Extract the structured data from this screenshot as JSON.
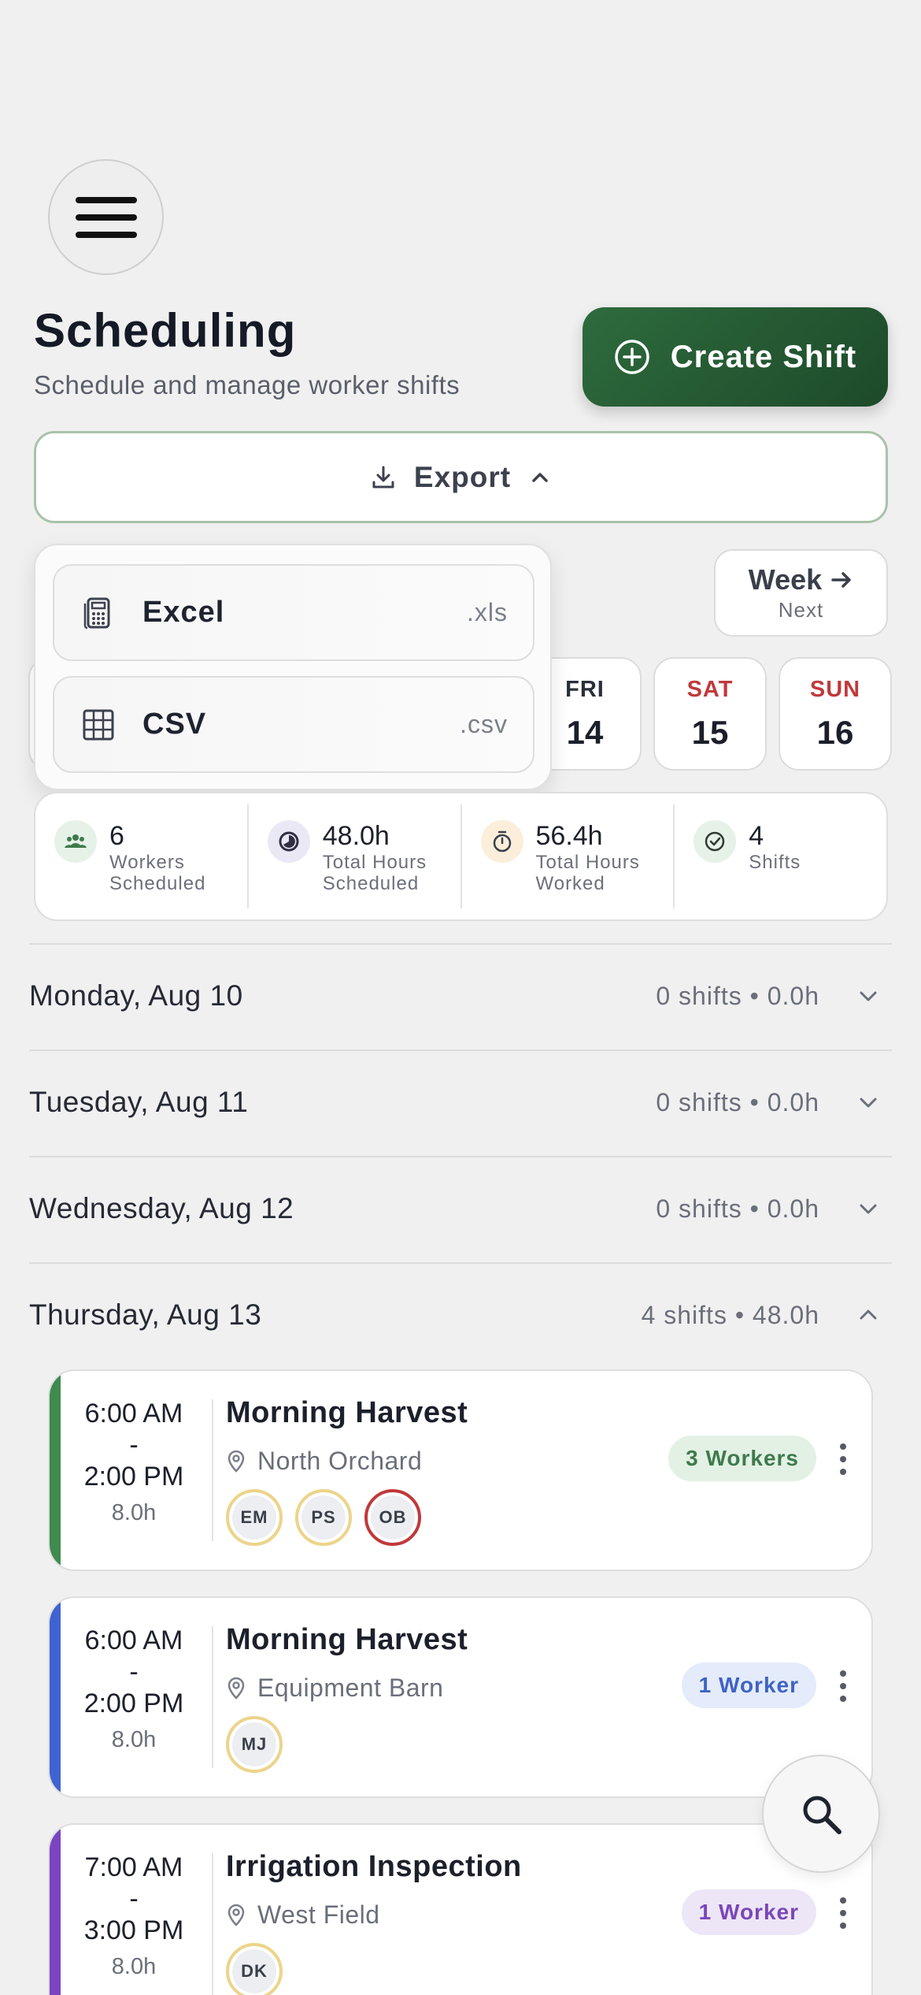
{
  "header": {
    "title": "Scheduling",
    "subtitle": "Schedule and manage worker shifts",
    "create_label": "Create Shift",
    "export_label": "Export"
  },
  "export_menu": [
    {
      "label": "Excel",
      "ext": ".xls",
      "icon": "calculator-icon"
    },
    {
      "label": "CSV",
      "ext": ".csv",
      "icon": "grid-icon"
    }
  ],
  "week_nav": {
    "label": "Week",
    "sub": "Next"
  },
  "day_chips": [
    {
      "name": "FRI",
      "date": "14",
      "weekend": false
    },
    {
      "name": "SAT",
      "date": "15",
      "weekend": true
    },
    {
      "name": "SUN",
      "date": "16",
      "weekend": true
    }
  ],
  "stats": [
    {
      "value": "6",
      "label1": "Workers",
      "label2": "Scheduled",
      "icon": "people-icon",
      "bg": "#e6f2e8",
      "fg": "#3f7a4c"
    },
    {
      "value": "48.0h",
      "label1": "Total Hours",
      "label2": "Scheduled",
      "icon": "clock-half-icon",
      "bg": "#ebe8f6",
      "fg": "#3a3a52"
    },
    {
      "value": "56.4h",
      "label1": "Total Hours",
      "label2": "Worked",
      "icon": "stopwatch-icon",
      "bg": "#fbeeda",
      "fg": "#3a3f4b"
    },
    {
      "value": "4",
      "label1": "Shifts",
      "label2": "",
      "icon": "check-circle-icon",
      "bg": "#e6f2e8",
      "fg": "#2f3a33"
    }
  ],
  "days": [
    {
      "label": "Monday, Aug 10",
      "summary": "0 shifts • 0.0h",
      "expanded": false
    },
    {
      "label": "Tuesday, Aug 11",
      "summary": "0 shifts • 0.0h",
      "expanded": false
    },
    {
      "label": "Wednesday, Aug 12",
      "summary": "0 shifts • 0.0h",
      "expanded": false
    },
    {
      "label": "Thursday, Aug 13",
      "summary": "4 shifts • 48.0h",
      "expanded": true
    }
  ],
  "shifts": [
    {
      "start": "6:00 AM",
      "dash": "-",
      "end": "2:00 PM",
      "hours": "8.0h",
      "title": "Morning Harvest",
      "location": "North Orchard",
      "badge": "3 Workers",
      "badge_bg": "#e3f1e5",
      "badge_fg": "#3f7a4c",
      "accent": "#3f8a4f",
      "workers": [
        {
          "initials": "EM",
          "late": false
        },
        {
          "initials": "PS",
          "late": false
        },
        {
          "initials": "OB",
          "late": true
        }
      ]
    },
    {
      "start": "6:00 AM",
      "dash": "-",
      "end": "2:00 PM",
      "hours": "8.0h",
      "title": "Morning Harvest",
      "location": "Equipment Barn",
      "badge": "1 Worker",
      "badge_bg": "#e4ebfa",
      "badge_fg": "#3f63c4",
      "accent": "#3f63d0",
      "workers": [
        {
          "initials": "MJ",
          "late": false
        }
      ]
    },
    {
      "start": "7:00 AM",
      "dash": "-",
      "end": "3:00 PM",
      "hours": "8.0h",
      "title": "Irrigation Inspection",
      "location": "West Field",
      "badge": "1 Worker",
      "badge_bg": "#ede6f7",
      "badge_fg": "#7a47b8",
      "accent": "#7a44c2",
      "workers": [
        {
          "initials": "DK",
          "late": false
        }
      ]
    }
  ]
}
